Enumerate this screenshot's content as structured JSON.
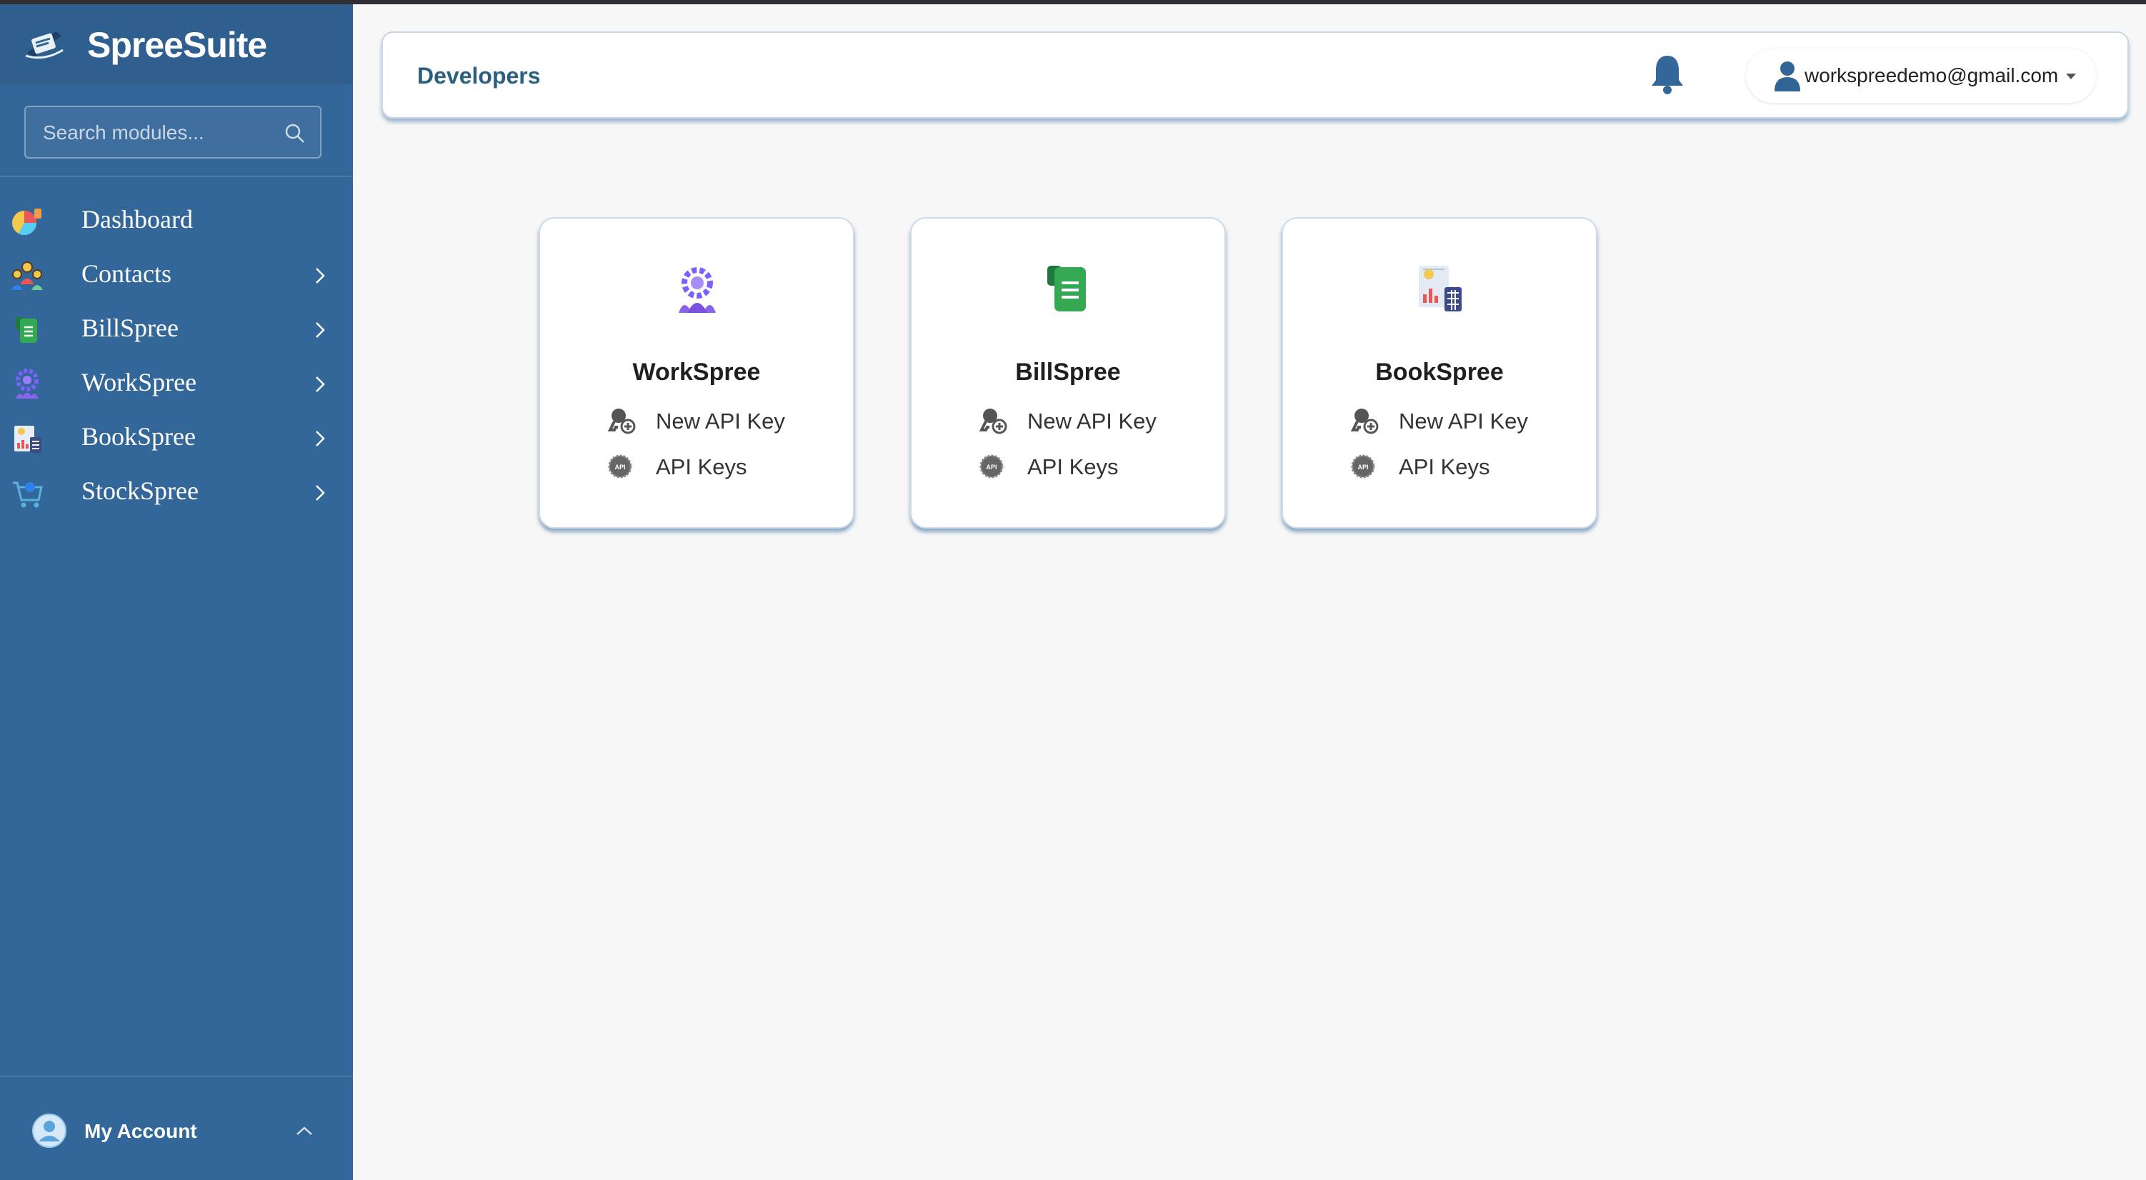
{
  "app": {
    "name": "SpreeSuite"
  },
  "search": {
    "placeholder": "Search modules..."
  },
  "sidebar": {
    "items": [
      {
        "label": "Dashboard",
        "icon": "dashboard-pie-icon",
        "has_children": false
      },
      {
        "label": "Contacts",
        "icon": "contacts-people-icon",
        "has_children": true
      },
      {
        "label": "BillSpree",
        "icon": "billspree-document-icon",
        "has_children": true
      },
      {
        "label": "WorkSpree",
        "icon": "workspree-gear-people-icon",
        "has_children": true
      },
      {
        "label": "BookSpree",
        "icon": "bookspree-ledger-icon",
        "has_children": true
      },
      {
        "label": "StockSpree",
        "icon": "stockspree-cart-icon",
        "has_children": true
      }
    ],
    "account": {
      "label": "My Account",
      "icon": "user-circle-icon"
    }
  },
  "header": {
    "title": "Developers",
    "notification_icon": "bell-icon",
    "user_email": "workspreedemo@gmail.com"
  },
  "cards": [
    {
      "title": "WorkSpree",
      "icon": "workspree-gear-people-icon",
      "links": [
        {
          "label": "New API Key",
          "icon": "key-user-add-icon"
        },
        {
          "label": "API Keys",
          "icon": "api-badge-icon"
        }
      ]
    },
    {
      "title": "BillSpree",
      "icon": "billspree-document-icon",
      "links": [
        {
          "label": "New API Key",
          "icon": "key-user-add-icon"
        },
        {
          "label": "API Keys",
          "icon": "api-badge-icon"
        }
      ]
    },
    {
      "title": "BookSpree",
      "icon": "bookspree-ledger-icon",
      "links": [
        {
          "label": "New API Key",
          "icon": "key-user-add-icon"
        },
        {
          "label": "API Keys",
          "icon": "api-badge-icon"
        }
      ]
    }
  ],
  "colors": {
    "sidebar_bg": "#336799",
    "brand_bg": "#2f5f8f",
    "page_bg": "#f7f7f8",
    "header_title": "#2b5f80",
    "bell": "#336799"
  }
}
